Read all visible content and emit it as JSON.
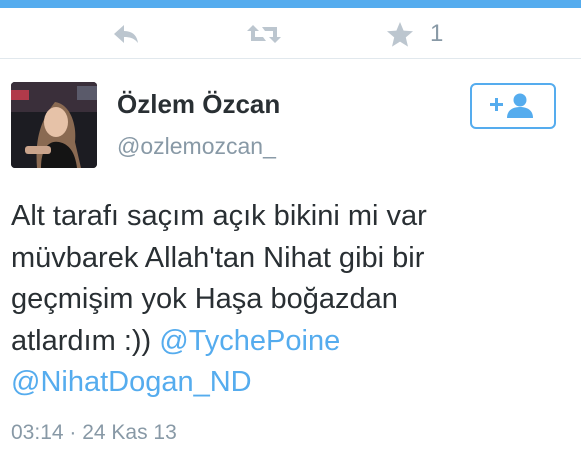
{
  "colors": {
    "accent": "#55acee",
    "text": "#292f33",
    "muted": "#8899a6",
    "divider": "#e1e8ed"
  },
  "actions": {
    "reply_icon": "reply-icon",
    "retweet_icon": "retweet-icon",
    "favorite_icon": "star-icon",
    "favorite_count": "1"
  },
  "author": {
    "name": "Özlem Özcan",
    "handle": "@ozlemozcan_"
  },
  "follow_button": {
    "icon": "follow-user-icon"
  },
  "tweet": {
    "line1": "Alt tarafı saçım açık bikini mi var",
    "line2": "müvbarek Allah'tan Nihat gibi bir",
    "line3": "geçmişim yok Haşa boğazdan",
    "line4_text": "atlardım :)) ",
    "mention1": "@TychePoine",
    "mention2": "@NihatDogan_ND"
  },
  "timestamp": "03:14 · 24 Kas 13"
}
